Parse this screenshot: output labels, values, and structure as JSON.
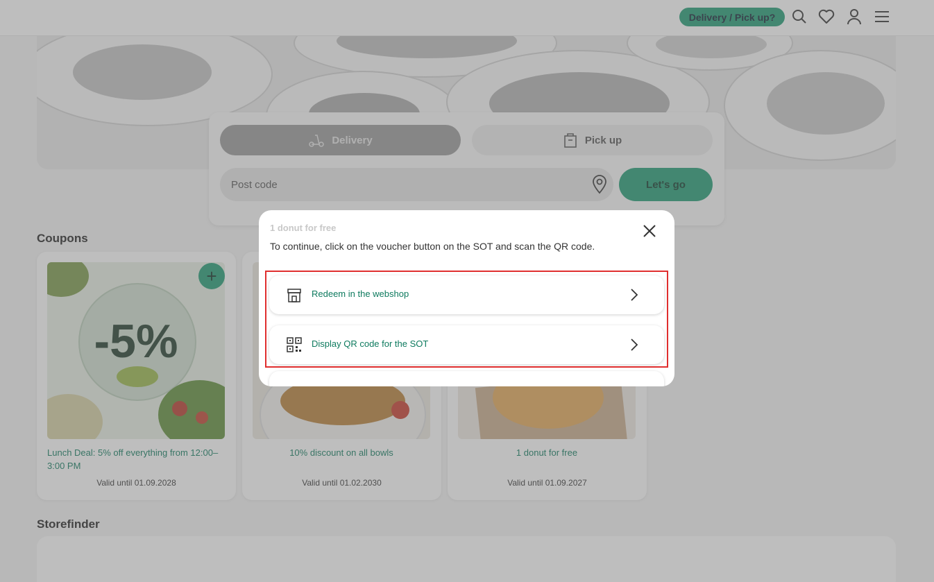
{
  "header": {
    "delivery_pickup_label": "Delivery / Pick up?",
    "icons": [
      "search-icon",
      "heart-icon",
      "user-icon",
      "menu-icon"
    ]
  },
  "search": {
    "delivery_label": "Delivery",
    "pickup_label": "Pick up",
    "postcode_placeholder": "Post code",
    "submit_label": "Let's go"
  },
  "coupons": {
    "section_title": "Coupons",
    "items": [
      {
        "badge": "-5%",
        "title": "Lunch Deal: 5% off everything from 12:00–3:00 PM",
        "valid": "Valid until 01.09.2028"
      },
      {
        "title": "10% discount on all bowls",
        "valid": "Valid until 01.02.2030"
      },
      {
        "title": "1 donut for free",
        "valid": "Valid until 01.09.2027"
      }
    ]
  },
  "storefinder": {
    "section_title": "Storefinder"
  },
  "modal": {
    "title": "1 donut for free",
    "description": "To continue, click on the voucher button on the SOT and scan the QR code.",
    "options": [
      {
        "label": "Redeem in the webshop",
        "icon": "store-icon"
      },
      {
        "label": "Display QR code for the SOT",
        "icon": "qr-code-icon"
      }
    ]
  },
  "colors": {
    "accent": "#1f9c74",
    "link_green": "#0d7a5e",
    "highlight": "#e02e2e"
  }
}
